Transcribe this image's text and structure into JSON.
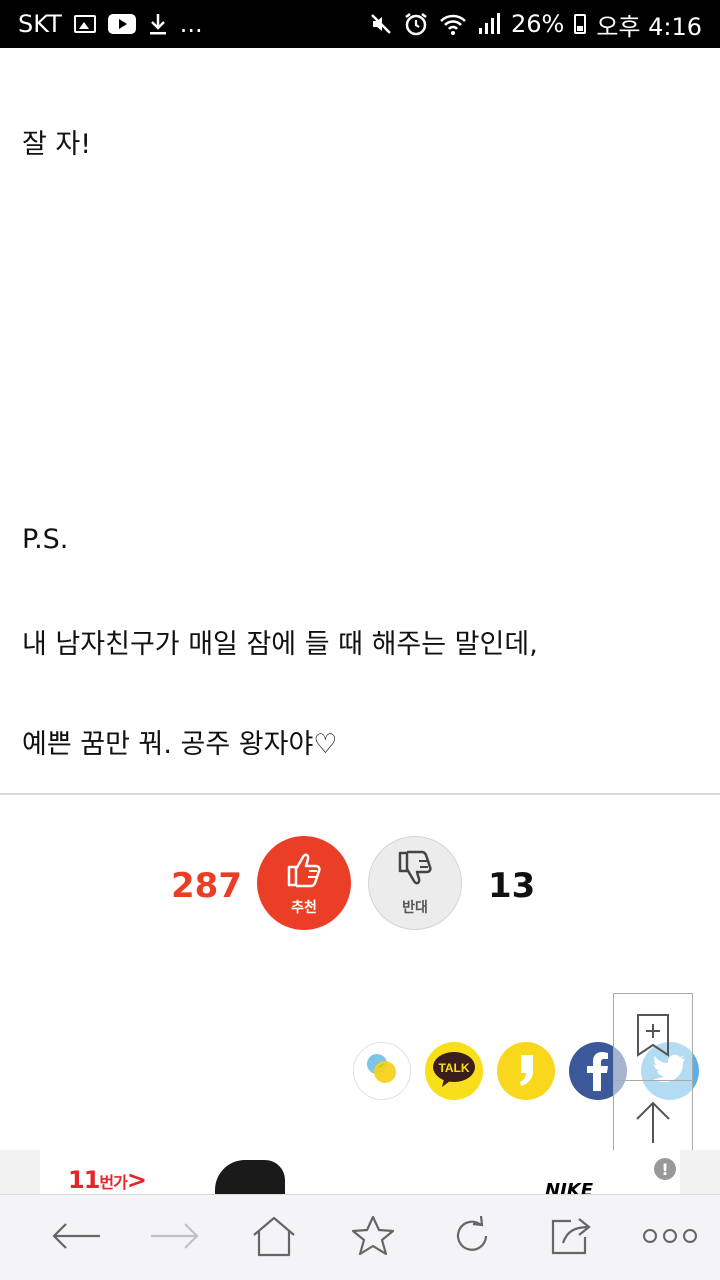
{
  "status_bar": {
    "carrier": "SKT",
    "more": "...",
    "battery": "26%",
    "time": "오후 4:16",
    "icons": [
      "image-icon",
      "youtube-icon",
      "download-icon",
      "mute-icon",
      "alarm-icon",
      "wifi-icon",
      "signal-icon",
      "battery-icon"
    ]
  },
  "article": {
    "lines": [
      "잘 자!",
      "P.S.",
      "내 남자친구가 매일 잠에 들 때 해주는 말인데,",
      "예쁜 꿈만 꿔. 공주 왕자야♡"
    ]
  },
  "votes": {
    "up_count": "287",
    "up_label": "추천",
    "down_label": "반대",
    "down_count": "13",
    "up_color": "#ea3f26",
    "down_color": "#ececec"
  },
  "share": {
    "kakao_talk_label": "TALK",
    "icons": [
      "kakao-story-icon",
      "kakao-talk-icon",
      "kakao-page-icon",
      "facebook-icon",
      "twitter-icon"
    ]
  },
  "floating": {
    "icons": [
      "bookmark-add-icon",
      "scroll-top-icon"
    ]
  },
  "ad": {
    "brand_11": "11",
    "brand_11_suffix": "번가",
    "brand_11_arrow": ">",
    "brand_nike": "NIKE"
  },
  "toolbar": {
    "icons": [
      "back-icon",
      "forward-icon",
      "home-icon",
      "bookmark-icon",
      "refresh-icon",
      "share-icon",
      "more-icon"
    ]
  }
}
